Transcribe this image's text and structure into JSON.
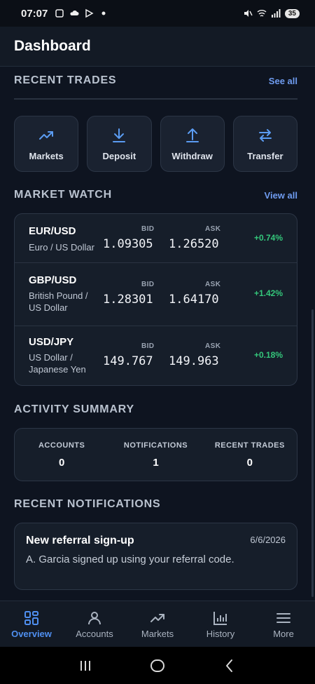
{
  "status_bar": {
    "time": "07:07",
    "battery": "35"
  },
  "header": {
    "title": "Dashboard"
  },
  "recent_trades": {
    "title": "RECENT TRADES",
    "link": "See all"
  },
  "quick_actions": [
    {
      "label": "Markets",
      "icon": "trending-up-icon"
    },
    {
      "label": "Deposit",
      "icon": "download-icon"
    },
    {
      "label": "Withdraw",
      "icon": "upload-icon"
    },
    {
      "label": "Transfer",
      "icon": "swap-arrows-icon"
    }
  ],
  "market_watch": {
    "title": "MARKET WATCH",
    "link": "View all",
    "bid_label": "BID",
    "ask_label": "ASK",
    "rows": [
      {
        "pair": "EUR/USD",
        "name": "Euro / US Dollar",
        "bid": "1.09305",
        "ask": "1.26520",
        "change": "+0.74%"
      },
      {
        "pair": "GBP/USD",
        "name": "British Pound / US Dollar",
        "bid": "1.28301",
        "ask": "1.64170",
        "change": "+1.42%"
      },
      {
        "pair": "USD/JPY",
        "name": "US Dollar / Japanese Yen",
        "bid": "149.767",
        "ask": "149.963",
        "change": "+0.18%"
      }
    ]
  },
  "activity_summary": {
    "title": "ACTIVITY SUMMARY",
    "items": [
      {
        "label": "ACCOUNTS",
        "value": "0"
      },
      {
        "label": "NOTIFICATIONS",
        "value": "1"
      },
      {
        "label": "RECENT TRADES",
        "value": "0"
      }
    ]
  },
  "recent_notifications": {
    "title": "RECENT NOTIFICATIONS",
    "items": [
      {
        "title": "New referral sign-up",
        "date": "6/6/2026",
        "body": "A. Garcia signed up using your referral code."
      }
    ]
  },
  "bottom_nav": [
    {
      "label": "Overview",
      "icon": "grid-icon",
      "active": true
    },
    {
      "label": "Accounts",
      "icon": "user-icon",
      "active": false
    },
    {
      "label": "Markets",
      "icon": "trending-up-icon",
      "active": false
    },
    {
      "label": "History",
      "icon": "bar-chart-icon",
      "active": false
    },
    {
      "label": "More",
      "icon": "menu-icon",
      "active": false
    }
  ],
  "colors": {
    "accent": "#4f8ff0",
    "positive": "#34c77b",
    "background": "#0e1420",
    "card": "#161e2a"
  }
}
